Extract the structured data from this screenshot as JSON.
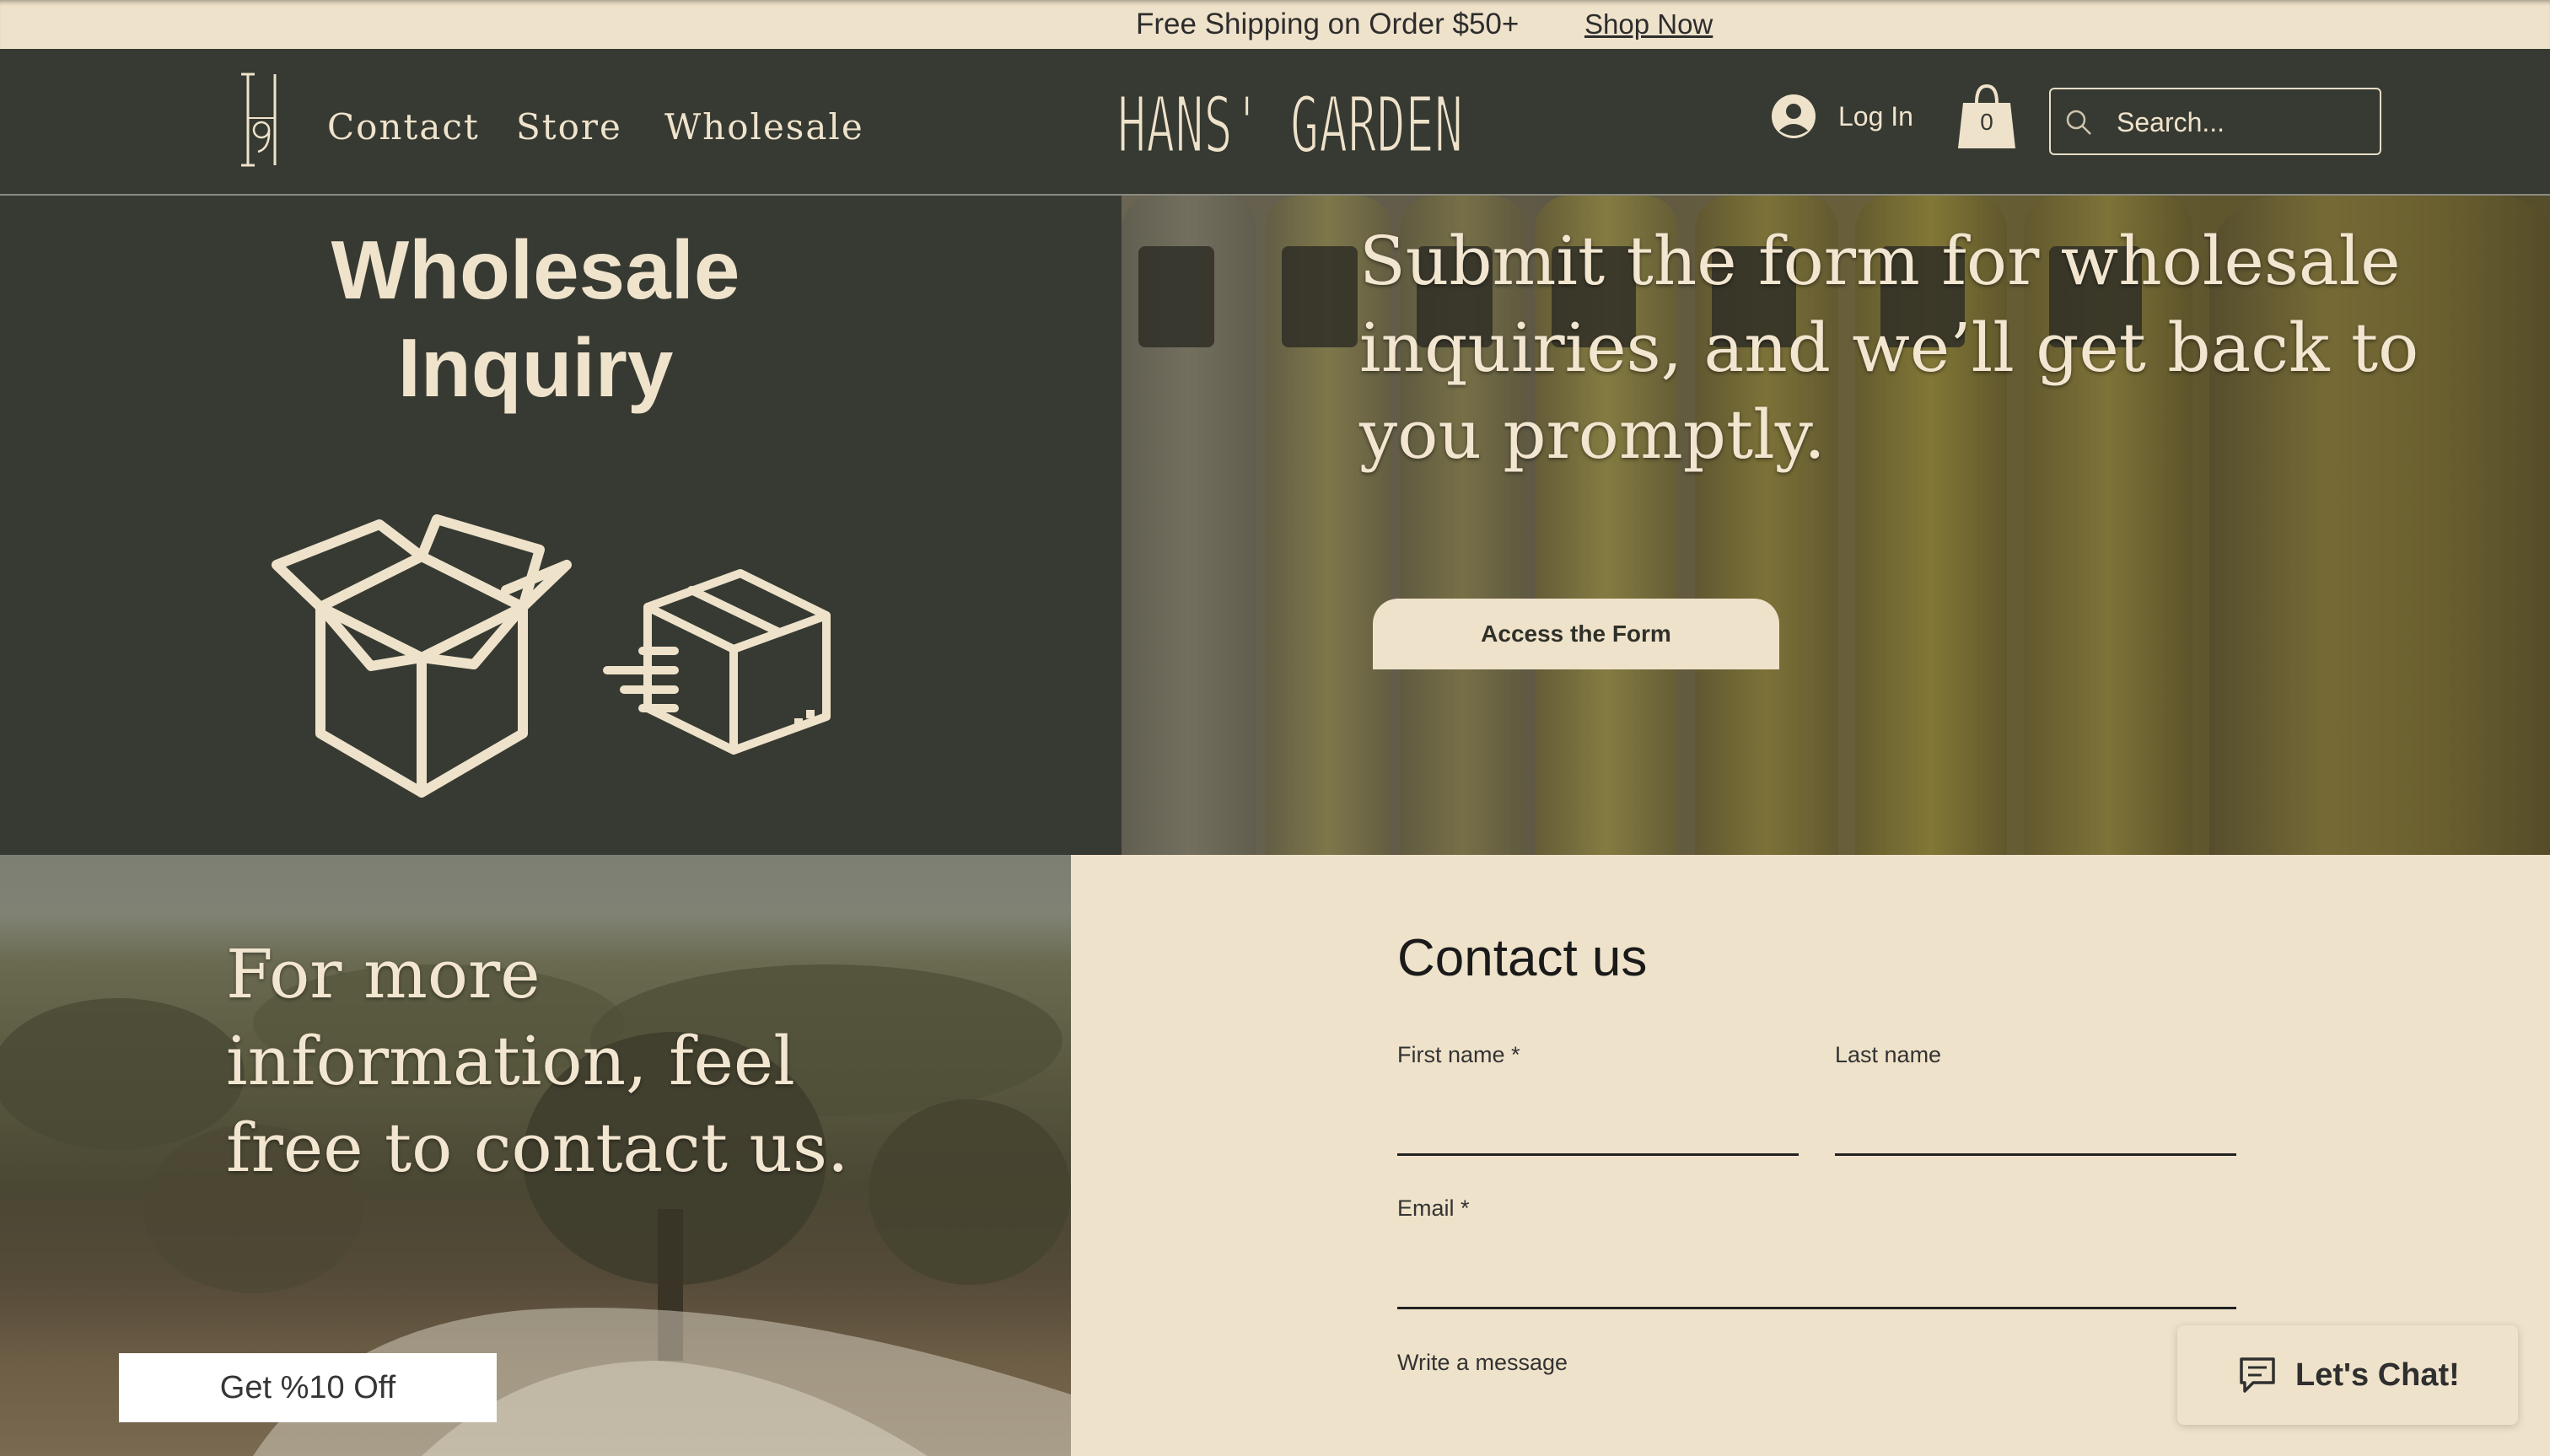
{
  "announcement": {
    "text": "Free Shipping on Order $50+",
    "link": "Shop Now"
  },
  "header": {
    "nav": [
      "Contact",
      "Store",
      "Wholesale"
    ],
    "brand": "HANS' GARDEN",
    "login": "Log In",
    "cart_count": "0",
    "search_placeholder": "Search..."
  },
  "wholesale": {
    "title_line1": "Wholesale",
    "title_line2": "Inquiry",
    "message": "Submit the form for wholesale inquiries, and we’ll get back to you promptly.",
    "button": "Access the Form"
  },
  "promo": {
    "text": "For more information, feel free to contact us.",
    "discount_button": "Get %10 Off"
  },
  "contact": {
    "title": "Contact us",
    "first_name_label": "First name *",
    "last_name_label": "Last name",
    "email_label": "Email *",
    "message_label": "Write a message"
  },
  "chat": {
    "label": "Let's Chat!"
  },
  "colors": {
    "dark_olive": "#363a32",
    "cream": "#efe2ca",
    "text_cream": "#f0e3cc"
  },
  "icons": {
    "logo": "hg-monogram-icon",
    "login": "user-avatar-icon",
    "cart": "shopping-bag-icon",
    "search": "magnifier-icon",
    "boxes": "open-box-icon",
    "delivery": "fast-delivery-box-icon",
    "chat": "chat-bubble-icon"
  }
}
